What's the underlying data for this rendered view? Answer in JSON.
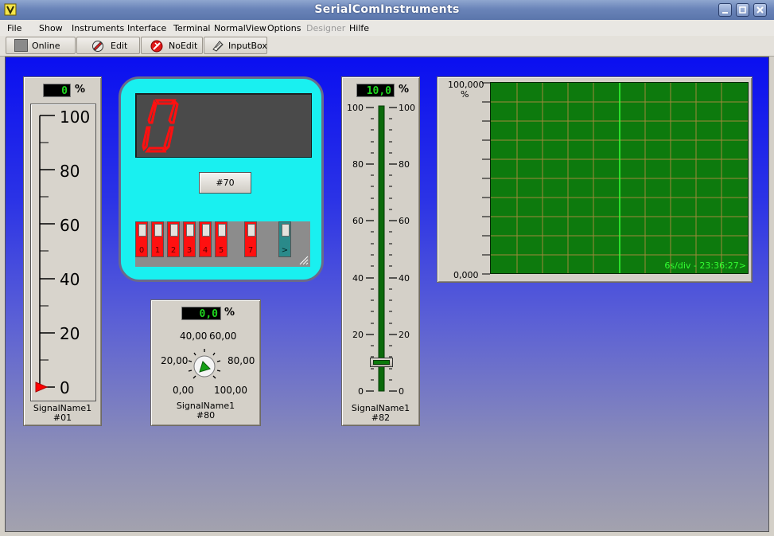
{
  "window": {
    "title": "SerialComInstruments"
  },
  "menu": [
    "File",
    "Show",
    "Instruments",
    "Interface",
    "Terminal",
    "NormalView",
    "Options",
    "Designer",
    "Hilfe"
  ],
  "toolbar": {
    "online": "Online",
    "edit": "Edit",
    "noedit": "NoEdit",
    "inputbox": "InputBox"
  },
  "thermometer": {
    "display": "0",
    "unit": "%",
    "ticks": [
      "100",
      "80",
      "60",
      "40",
      "20",
      "0"
    ],
    "value_fraction": 0.0,
    "signal": "SignalName1",
    "id": "#01"
  },
  "segment_panel": {
    "digit": "0",
    "button": "#70",
    "switches": [
      "0",
      "1",
      "2",
      "3",
      "4",
      "5",
      "7",
      ">"
    ]
  },
  "knob": {
    "display": "0,0",
    "unit": "%",
    "labels": {
      "l4000": "40,00",
      "l6000": "60,00",
      "l2000": "20,00",
      "l8000": "80,00",
      "l000": "0,00",
      "l10000": "100,00"
    },
    "signal": "SignalName1",
    "id": "#80"
  },
  "slider": {
    "display": "10,0",
    "unit": "%",
    "ticks": [
      "100",
      "80",
      "60",
      "40",
      "20",
      "0"
    ],
    "value_fraction": 0.1,
    "signal": "SignalName1",
    "id": "#82"
  },
  "scope": {
    "ymax": "100,000",
    "yunit": "%",
    "ymin": "0,000",
    "status": "6s/div - 23:36:27>"
  },
  "colors": {
    "lcd_text": "#1fd81f",
    "scope_bg": "#0d7a0d",
    "panel_cyan": "#19f0f0",
    "segment_red": "#ff1010"
  }
}
